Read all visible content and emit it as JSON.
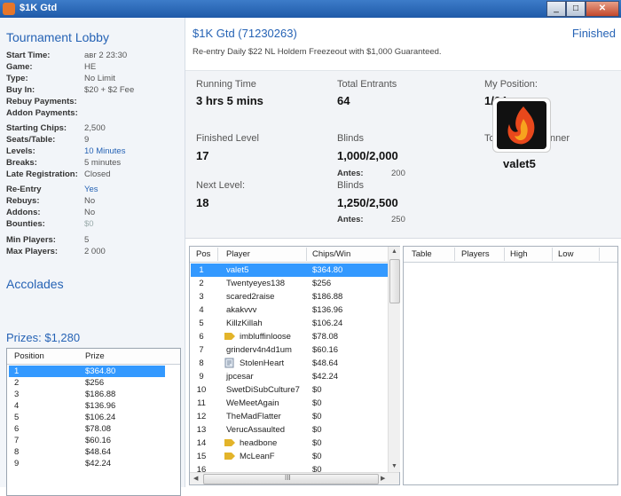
{
  "window": {
    "title": "$1K Gtd",
    "controls": [
      "_",
      "□",
      "✕"
    ]
  },
  "left": {
    "lobby_title": "Tournament Lobby",
    "info": [
      {
        "k": "Start Time:",
        "v": "авг 2 23:30"
      },
      {
        "k": "Game:",
        "v": "HE"
      },
      {
        "k": "Type:",
        "v": "No Limit"
      },
      {
        "k": "Buy In:",
        "v": "$20 + $2 Fee"
      },
      {
        "k": "Rebuy Payments:",
        "v": ""
      },
      {
        "k": "Addon Payments:",
        "v": ""
      },
      {
        "k": "Starting Chips:",
        "v": "2,500"
      },
      {
        "k": "Seats/Table:",
        "v": "9"
      },
      {
        "k": "Levels:",
        "v": "10 Minutes"
      },
      {
        "k": "Breaks:",
        "v": "5 minutes"
      },
      {
        "k": "Late Registration:",
        "v": "Closed"
      },
      {
        "k": "Re-Entry",
        "v": "Yes"
      },
      {
        "k": "Rebuys:",
        "v": "No"
      },
      {
        "k": "Addons:",
        "v": "No"
      },
      {
        "k": "Bounties:",
        "v": "$0"
      },
      {
        "k": "Min Players:",
        "v": "5"
      },
      {
        "k": "Max Players:",
        "v": "2 000"
      }
    ],
    "accolades": "Accolades",
    "prizes_label": "Prizes: $1,280",
    "prize_headers": {
      "position": "Position",
      "prize": "Prize"
    },
    "prizes": [
      {
        "pos": "1",
        "prize": "$364.80"
      },
      {
        "pos": "2",
        "prize": "$256"
      },
      {
        "pos": "3",
        "prize": "$186.88"
      },
      {
        "pos": "4",
        "prize": "$136.96"
      },
      {
        "pos": "5",
        "prize": "$106.24"
      },
      {
        "pos": "6",
        "prize": "$78.08"
      },
      {
        "pos": "7",
        "prize": "$60.16"
      },
      {
        "pos": "8",
        "prize": "$48.64"
      },
      {
        "pos": "9",
        "prize": "$42.24"
      }
    ]
  },
  "main": {
    "name": "$1K Gtd (71230263)",
    "status": "Finished",
    "description": "Re-entry Daily $22 NL Holdem Freezeout with $1,000 Guaranteed.",
    "running_time_label": "Running Time",
    "running_time": "3 hrs 5 mins",
    "total_entrants_label": "Total Entrants",
    "total_entrants": "64",
    "my_position_label": "My Position:",
    "my_position": "1/64",
    "finished_level_label": "Finished Level",
    "finished_level": "17",
    "blinds_label": "Blinds",
    "blinds": "1,000/2,000",
    "antes_label": "Antes:",
    "antes": "200",
    "next_level_label": "Next Level:",
    "next_level": "18",
    "next_blinds_label": "Blinds",
    "next_blinds": "1,250/2,500",
    "next_antes_label": "Antes:",
    "next_antes": "250",
    "winner_label": "Tournament Winner",
    "winner": "valet5"
  },
  "players": {
    "headers": {
      "pos": "Pos",
      "player": "Player",
      "chips": "Chips/Win"
    },
    "rows": [
      {
        "pos": "1",
        "name": "valet5",
        "chips": "$364.80",
        "icon": ""
      },
      {
        "pos": "2",
        "name": "Twentyeyes138",
        "chips": "$256",
        "icon": ""
      },
      {
        "pos": "3",
        "name": "scared2raise",
        "chips": "$186.88",
        "icon": ""
      },
      {
        "pos": "4",
        "name": "akakvvv",
        "chips": "$136.96",
        "icon": ""
      },
      {
        "pos": "5",
        "name": "KillzKillah",
        "chips": "$106.24",
        "icon": ""
      },
      {
        "pos": "6",
        "name": "imbluffinloose",
        "chips": "$78.08",
        "icon": "flag-icon"
      },
      {
        "pos": "7",
        "name": "grinderv4n4d1um",
        "chips": "$60.16",
        "icon": ""
      },
      {
        "pos": "8",
        "name": "StolenHeart",
        "chips": "$48.64",
        "icon": "note-icon"
      },
      {
        "pos": "9",
        "name": "jpcesar",
        "chips": "$42.24",
        "icon": ""
      },
      {
        "pos": "10",
        "name": "SwetDiSubCulture7",
        "chips": "$0",
        "icon": ""
      },
      {
        "pos": "11",
        "name": "WeMeetAgain",
        "chips": "$0",
        "icon": ""
      },
      {
        "pos": "12",
        "name": "TheMadFlatter",
        "chips": "$0",
        "icon": ""
      },
      {
        "pos": "13",
        "name": "VerucAssaulted",
        "chips": "$0",
        "icon": ""
      },
      {
        "pos": "14",
        "name": "headbone",
        "chips": "$0",
        "icon": "flag-icon"
      },
      {
        "pos": "15",
        "name": "McLeanF",
        "chips": "$0",
        "icon": "flag-icon"
      },
      {
        "pos": "16",
        "name": "",
        "chips": "$0",
        "icon": ""
      }
    ],
    "hscroll_grip": "III"
  },
  "tables": {
    "headers": {
      "table": "Table",
      "players": "Players",
      "high": "High",
      "low": "Low"
    }
  },
  "colors": {
    "accent": "#2663b5",
    "selection": "#3399ff",
    "titlebar": "#2b6bbd"
  }
}
